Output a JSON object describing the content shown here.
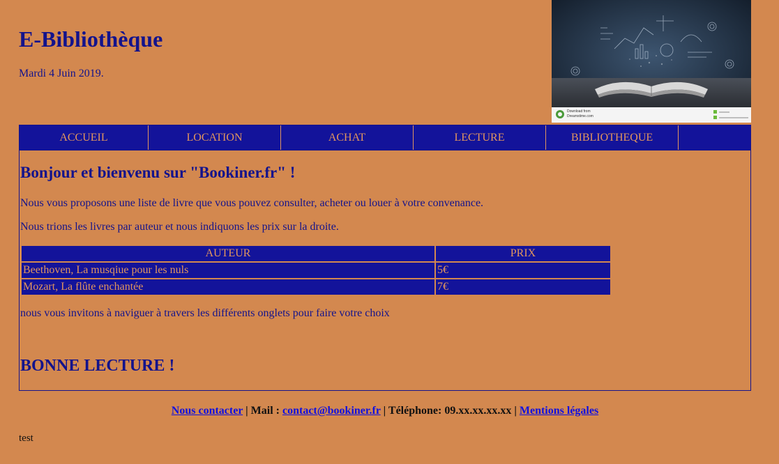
{
  "header": {
    "title": "E-Bibliothèque",
    "date": "Mardi 4 Juin 2019.",
    "image": {
      "download_from": "Download from",
      "source": "Dreamstime.com"
    }
  },
  "nav": {
    "items": [
      {
        "label": "ACCUEIL"
      },
      {
        "label": "LOCATION"
      },
      {
        "label": "ACHAT"
      },
      {
        "label": "LECTURE"
      },
      {
        "label": "BIBLIOTHEQUE"
      }
    ]
  },
  "main": {
    "welcome": "Bonjour et bienvenu sur \"Bookiner.fr\" !",
    "intro1": "Nous vous proposons une liste de livre que vous pouvez consulter, acheter ou louer à votre convenance.",
    "intro2": "Nous trions les livres par auteur et nous indiquons les prix sur la droite.",
    "table": {
      "headers": [
        "AUTEUR",
        "PRIX"
      ],
      "rows": [
        [
          "Beethoven, La musqiue pour les nuls",
          "5€"
        ],
        [
          "Mozart, La flûte enchantée",
          "7€"
        ]
      ]
    },
    "invite": "nous vous invitons à naviguer à travers les différents onglets pour faire votre choix",
    "closing": "BONNE LECTURE !"
  },
  "footer": {
    "contact_link": "Nous contacter",
    "sep1": " | ",
    "mail_label": "Mail : ",
    "email": "contact@bookiner.fr",
    "sep2": " | ",
    "phone": "Téléphone: 09.xx.xx.xx.xx",
    "sep3": " | ",
    "legal_link": "Mentions légales"
  },
  "bottom_text": "test"
}
